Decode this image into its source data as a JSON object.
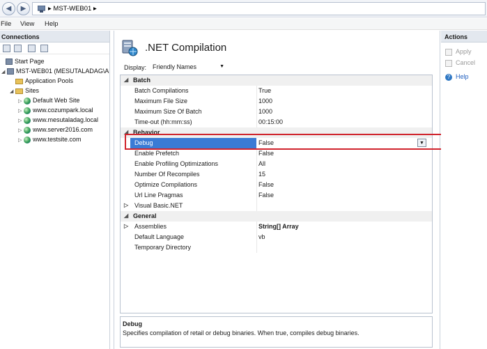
{
  "address": {
    "server": "MST-WEB01",
    "separator": "▸"
  },
  "menu": {
    "file": "File",
    "view": "View",
    "help": "Help"
  },
  "connections": {
    "title": "Connections",
    "tree": [
      {
        "label": "Start Page"
      },
      {
        "label": "MST-WEB01 (MESUTALADAG\\A"
      },
      {
        "label": "Application Pools"
      },
      {
        "label": "Sites"
      },
      {
        "label": "Default Web Site"
      },
      {
        "label": "www.cozumpark.local"
      },
      {
        "label": "www.mesutaladag.local"
      },
      {
        "label": "www.server2016.com"
      },
      {
        "label": "www.testsite.com"
      }
    ]
  },
  "page": {
    "title": ".NET Compilation",
    "display_label": "Display:",
    "display_value": "Friendly Names"
  },
  "grid": {
    "batch": {
      "title": "Batch",
      "rows": [
        {
          "name": "Batch Compilations",
          "value": "True"
        },
        {
          "name": "Maximum File Size",
          "value": "1000"
        },
        {
          "name": "Maximum Size Of Batch",
          "value": "1000"
        },
        {
          "name": "Time-out (hh:mm:ss)",
          "value": "00:15:00"
        }
      ]
    },
    "behavior": {
      "title": "Behavior",
      "rows": [
        {
          "name": "Debug",
          "value": "False"
        },
        {
          "name": "Enable Prefetch",
          "value": "False"
        },
        {
          "name": "Enable Profiling Optimizations",
          "value": "All"
        },
        {
          "name": "Number Of Recompiles",
          "value": "15"
        },
        {
          "name": "Optimize Compilations",
          "value": "False"
        },
        {
          "name": "Url Line Pragmas",
          "value": "False"
        },
        {
          "name": "Visual Basic.NET",
          "value": ""
        }
      ]
    },
    "general": {
      "title": "General",
      "rows": [
        {
          "name": "Assemblies",
          "value": "String[] Array"
        },
        {
          "name": "Default Language",
          "value": "vb"
        },
        {
          "name": "Temporary Directory",
          "value": ""
        }
      ]
    }
  },
  "description": {
    "title": "Debug",
    "text": "Specifies compilation of retail or debug binaries. When true, compiles debug binaries."
  },
  "actions": {
    "title": "Actions",
    "apply": "Apply",
    "cancel": "Cancel",
    "help": "Help"
  },
  "icons": {
    "back": "back-arrow-icon",
    "forward": "forward-arrow-icon",
    "server": "server-icon",
    "globe": "globe-icon",
    "folder": "folder-icon"
  },
  "colors": {
    "selection": "#3a7bd5",
    "highlight_box": "#d0232c",
    "link": "#1f5fbf"
  }
}
